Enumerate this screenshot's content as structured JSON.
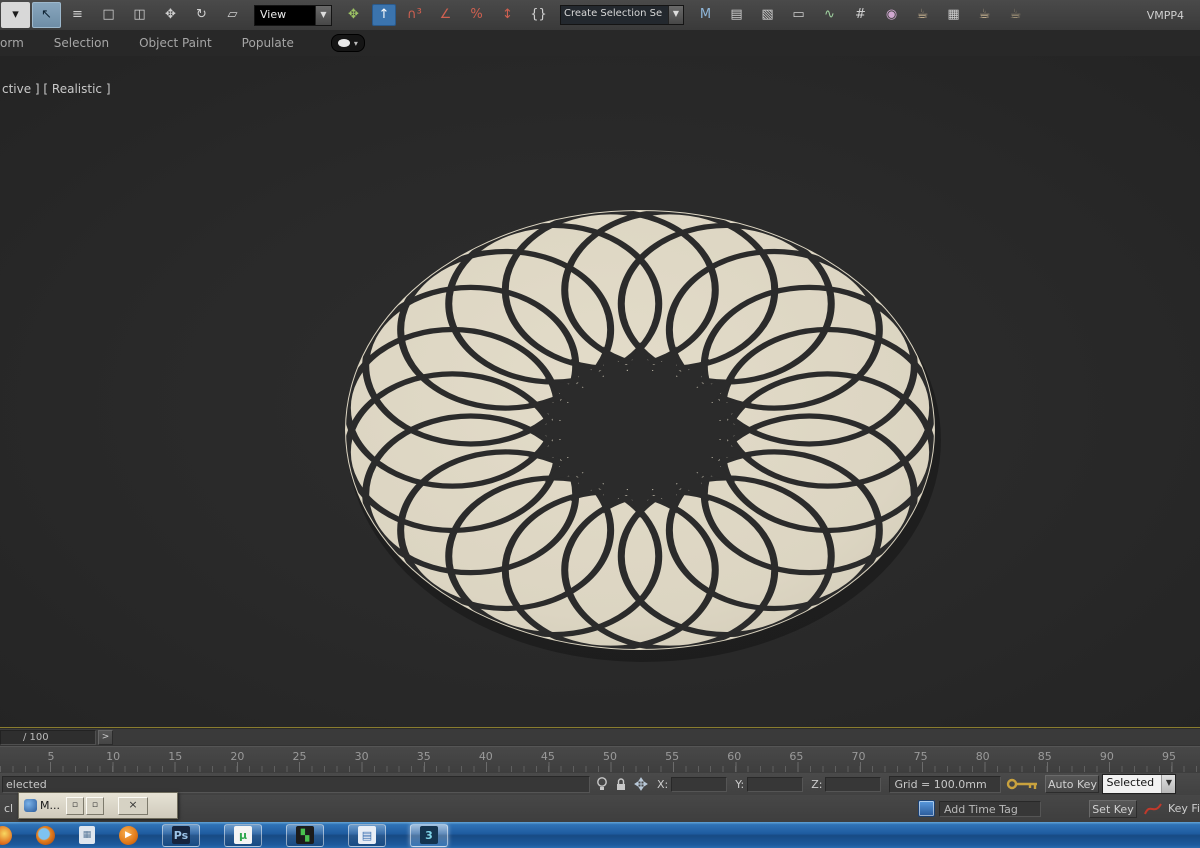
{
  "toolbar": {
    "view_dropdown_label": "View",
    "view_dropdown_arrow": "▼",
    "selection_set_text": "Create Selection Se",
    "selection_set_arrow": "▼",
    "workstation_label": "VMPP4",
    "groups": {
      "left": [
        {
          "name": "flyout-partial",
          "glyph": "▾",
          "color": "#1c1c1c",
          "bg": "#d8d8d8"
        },
        {
          "name": "select-object",
          "glyph": "↖",
          "color": "#0d2233",
          "sel": true
        },
        {
          "name": "select-by-name",
          "glyph": "≡",
          "color": "#cfcfcf"
        },
        {
          "name": "selection-region",
          "glyph": "□",
          "color": "#cfcfcf"
        },
        {
          "name": "window-crossing",
          "glyph": "◫",
          "color": "#cfcfcf"
        },
        {
          "name": "select-and-move",
          "glyph": "✥",
          "color": "#cfcfcf"
        },
        {
          "name": "select-and-rotate",
          "glyph": "↻",
          "color": "#cfcfcf"
        },
        {
          "name": "select-and-scale",
          "glyph": "▱",
          "color": "#cfcfcf"
        }
      ],
      "mid": [
        {
          "name": "select-and-manipulate",
          "glyph": "✥",
          "color": "#9cc264"
        },
        {
          "name": "keyboard-shortcut-override",
          "glyph": "↑",
          "color": "#ffffff",
          "boxed": true
        },
        {
          "name": "snaps-toggle",
          "glyph": "∩³",
          "color": "#d06050"
        },
        {
          "name": "angle-snap",
          "glyph": "∠",
          "color": "#d06050"
        },
        {
          "name": "percent-snap",
          "glyph": "%",
          "color": "#d06050"
        },
        {
          "name": "spinner-snap",
          "glyph": "↕",
          "color": "#d06050"
        },
        {
          "name": "edit-named-selection-sets",
          "glyph": "{}",
          "color": "#cfcfcf"
        }
      ],
      "right": [
        {
          "name": "mirror",
          "glyph": "M",
          "color": "#8fb6d8"
        },
        {
          "name": "align",
          "glyph": "▤",
          "color": "#cfcfcf"
        },
        {
          "name": "layer-manager",
          "glyph": "▧",
          "color": "#cfcfcf"
        },
        {
          "name": "graphite-toggle",
          "glyph": "▭",
          "color": "#cfcfcf"
        },
        {
          "name": "curve-editor",
          "glyph": "∿",
          "color": "#9fd09f"
        },
        {
          "name": "schematic-view",
          "glyph": "#",
          "color": "#cfcfcf"
        },
        {
          "name": "material-editor",
          "glyph": "◉",
          "color": "#d0a8d0"
        },
        {
          "name": "render-setup",
          "glyph": "☕",
          "color": "#d8c09a"
        },
        {
          "name": "rendered-frame-window",
          "glyph": "▦",
          "color": "#cfcfcf"
        },
        {
          "name": "render-production",
          "glyph": "☕",
          "color": "#d8c09a"
        },
        {
          "name": "render-iterative",
          "glyph": "☕",
          "color": "#b0a080"
        }
      ]
    }
  },
  "ribbon": {
    "tabs": [
      "orm",
      "Selection",
      "Object Paint",
      "Populate"
    ],
    "more_button_arrow": "▾"
  },
  "viewport": {
    "label": "ctive ] [ Realistic ]",
    "object": {
      "petals": 20,
      "ring_radius": 190,
      "circle_radius": 105,
      "squash": 0.7458,
      "outer_rx": 295,
      "outer_ry": 220,
      "stroke_width": 7,
      "hole_inner": 80,
      "hole_outer": 118,
      "fill": "#DCD5C2",
      "line": "#2B2B2B",
      "hole_fill": "#2B2B2B"
    }
  },
  "timeline": {
    "frame_field": "/ 100",
    "next_button": ">",
    "ticks": [
      "5",
      "10",
      "15",
      "20",
      "25",
      "30",
      "35",
      "40",
      "45",
      "50",
      "55",
      "60",
      "65",
      "70",
      "75",
      "80",
      "85",
      "90",
      "95"
    ]
  },
  "status": {
    "prompt": "elected",
    "x_label": "X:",
    "y_label": "Y:",
    "z_label": "Z:",
    "grid_text": "Grid = 100.0mm",
    "auto_key": "Auto Key",
    "selected_dropdown": "Selected",
    "selected_arrow": "▼",
    "set_key": "Set Key",
    "add_time_tag": "Add Time Tag",
    "key_filters": "Key Fi",
    "prompt2": "cl"
  },
  "mini_window": {
    "title": "M...",
    "restore_button": "▫",
    "maximize_button": "▫",
    "close_button": "×"
  },
  "taskbar": {
    "items": [
      {
        "name": "edge-app",
        "style": "circle",
        "bg": "radial-gradient(circle at 60% 40%, #f8d860, #e07020 60%, #a04010)",
        "edge": true
      },
      {
        "name": "firefox",
        "style": "circle",
        "bg": "radial-gradient(circle at 42% 42%, #7ec3f0 0 34%, #e8821e 42%, #b85410 80%)"
      },
      {
        "name": "calculator",
        "style": "plain",
        "glyph": "▦",
        "bg": "#dfe6ee",
        "fg": "#5a7a9a"
      },
      {
        "name": "media-player",
        "style": "circle-glyph",
        "glyph": "▶",
        "bg": "radial-gradient(circle at 40% 35%, #f8b050, #e07818 60%, #b04c08)",
        "fg": "#ffffff"
      },
      {
        "name": "photoshop",
        "style": "frame",
        "glyph": "Ps",
        "bg": "#16243e",
        "fg": "#9cc3e8"
      },
      {
        "name": "utorrent",
        "style": "frame",
        "glyph": "µ",
        "bg": "#f4f4f4",
        "fg": "#2fa84f"
      },
      {
        "name": "green-app",
        "style": "frame",
        "glyph": "▚",
        "bg": "#1c1c1c",
        "fg": "#49c14f"
      },
      {
        "name": "keyboard-app",
        "style": "frame",
        "glyph": "▤",
        "bg": "#e8eef6",
        "fg": "#3a6fb0"
      },
      {
        "name": "3dsmax-app",
        "style": "frame",
        "glyph": "3",
        "bg": "#14344f",
        "fg": "#7fd4e8",
        "active": true
      }
    ]
  }
}
